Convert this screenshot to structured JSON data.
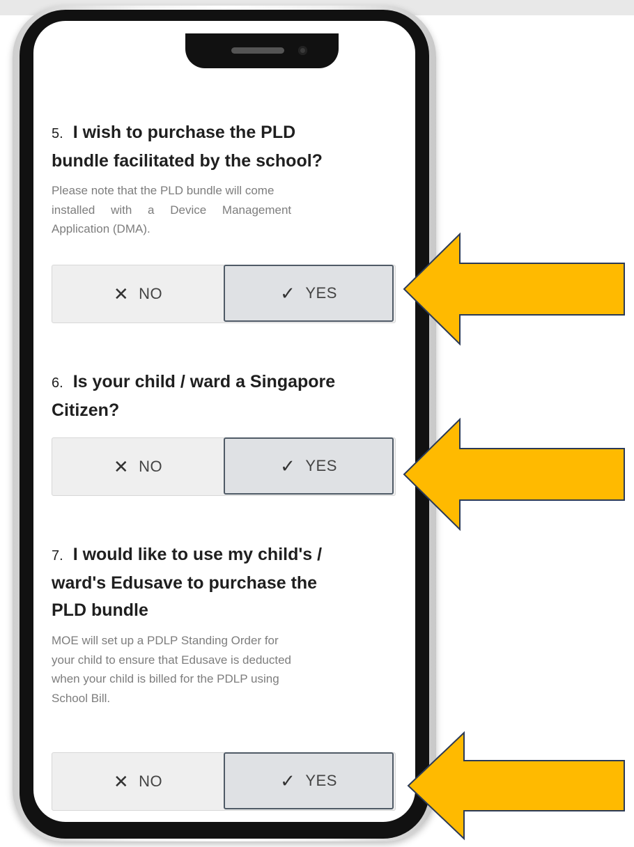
{
  "questions": [
    {
      "number": "5.",
      "title_lines": [
        "I wish to purchase the PLD",
        "bundle facilitated by the school?"
      ],
      "note_lines": [
        "Please note that the PLD bundle will come",
        "installed with a Device Management",
        "Application (DMA)."
      ],
      "no_label": "NO",
      "yes_label": "YES",
      "selected": "YES"
    },
    {
      "number": "6.",
      "title_lines": [
        "Is your child / ward a Singapore",
        "Citizen?"
      ],
      "note_lines": [],
      "no_label": "NO",
      "yes_label": "YES",
      "selected": "YES"
    },
    {
      "number": "7.",
      "title_lines": [
        "I would like to use my child's /",
        "ward's Edusave to purchase the",
        "PLD bundle"
      ],
      "note_lines": [
        "MOE will set up a PDLP Standing Order for",
        "your child to ensure that Edusave is deducted",
        "when your child is billed for the PDLP using",
        "School Bill."
      ],
      "no_label": "NO",
      "yes_label": "YES",
      "selected": "YES"
    }
  ],
  "icons": {
    "no": "close-icon",
    "yes": "check-icon",
    "pointer": "left-arrow-icon"
  },
  "colors": {
    "arrow_fill": "#FFBA00",
    "arrow_stroke": "#2B3A57",
    "selected_border": "#4F5A66",
    "selected_bg": "#DFE1E4"
  }
}
